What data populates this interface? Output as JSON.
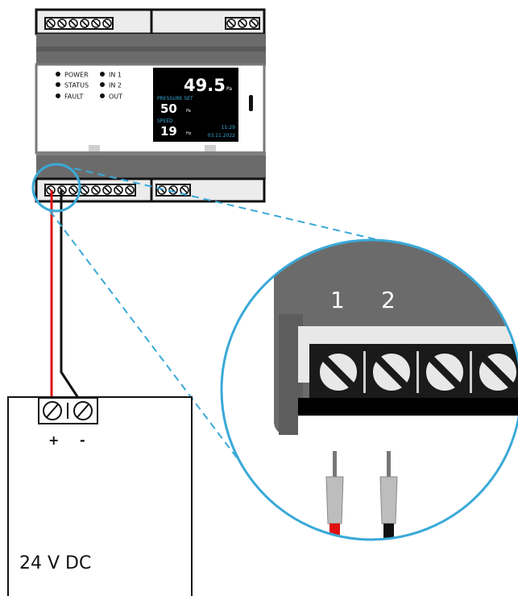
{
  "device": {
    "leds": [
      {
        "label": "POWER"
      },
      {
        "label": "STATUS"
      },
      {
        "label": "FAULT"
      },
      {
        "label": "IN 1"
      },
      {
        "label": "IN 2"
      },
      {
        "label": "OUT"
      }
    ],
    "display": {
      "main_value": "49.5",
      "main_unit": "Pa",
      "setpoint_label": "PRESSURE SET",
      "setpoint_value": "50",
      "setpoint_unit": "Pa",
      "speed_label": "SPEED",
      "speed_value": "19",
      "speed_unit": "Hz",
      "time": "11:29",
      "date": "03.11.2022"
    }
  },
  "zoom": {
    "terminal_numbers": [
      "1",
      "2"
    ]
  },
  "power_supply": {
    "plus_label": "+",
    "minus_label": "-",
    "label": "24 V DC"
  },
  "colors": {
    "highlight_circle": "#3aa9d8",
    "positive_wire": "#e01010",
    "negative_wire": "#111111",
    "housing_dark": "#6b6b6b",
    "housing_light": "#e6e6e6",
    "display_bg": "#000000",
    "display_accent": "#3aa9d8"
  }
}
